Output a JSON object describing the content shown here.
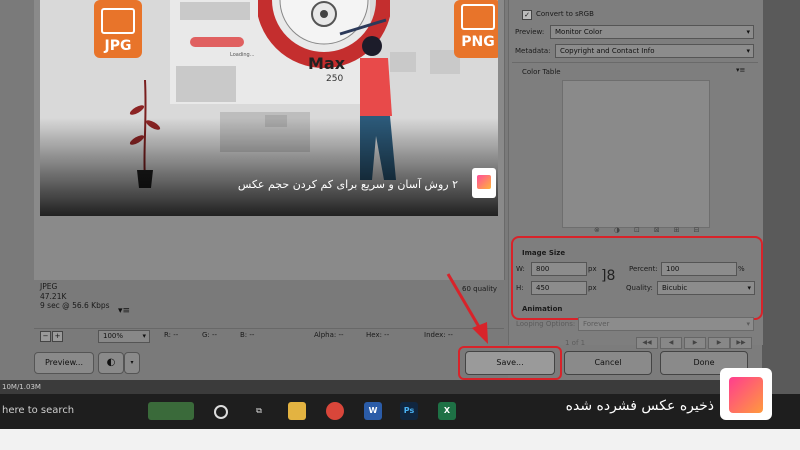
{
  "preview_image": {
    "left_badge": "JPG",
    "right_badge": "PNG",
    "loading_text": "Loading...",
    "gauge_label": "Max",
    "gauge_value": "250",
    "caption": "۲ روش آسان و سریع برای کم کردن حجم عکس"
  },
  "file_info": {
    "format": "JPEG",
    "size": "47.21K",
    "time": "9 sec @ 56.6 Kbps",
    "quality_note": "60 quality"
  },
  "zoom_bar": {
    "zoom": "100%",
    "r": "R: --",
    "g": "G: --",
    "b": "B: --",
    "alpha": "Alpha: --",
    "hex": "Hex: --",
    "index": "Index: --"
  },
  "left_buttons": {
    "preview": "Preview..."
  },
  "right_panel": {
    "convert_label": "Convert to sRGB",
    "preview_label": "Preview:",
    "preview_value": "Monitor Color",
    "metadata_label": "Metadata:",
    "metadata_value": "Copyright and Contact Info",
    "color_table_label": "Color Table",
    "image_size_label": "Image Size",
    "w_label": "W:",
    "w_value": "800",
    "h_label": "H:",
    "h_value": "450",
    "px": "px",
    "percent_label": "Percent:",
    "percent_value": "100",
    "percent_unit": "%",
    "quality_label": "Quality:",
    "quality_value": "Bicubic",
    "animation_label": "Animation",
    "looping_label": "Looping Options:",
    "looping_value": "Forever",
    "frame_counter": "1 of 1"
  },
  "dialog_buttons": {
    "save": "Save...",
    "cancel": "Cancel",
    "done": "Done"
  },
  "taskbar": {
    "status": "10M/1.03M",
    "search": "here to search"
  },
  "overlay": {
    "caption": "ذخیره عکس فشرده شده"
  },
  "colors": {
    "highlight": "#d8232a",
    "badge_orange": "#e8742a"
  }
}
